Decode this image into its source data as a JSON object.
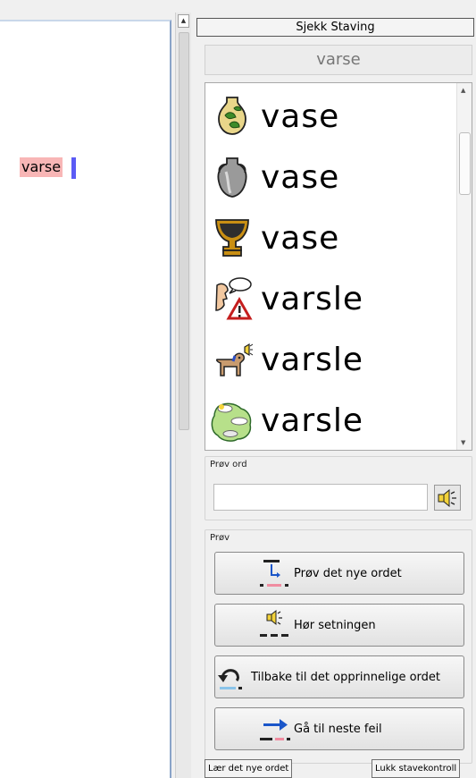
{
  "document": {
    "misspelled_word": "varse"
  },
  "panel": {
    "title": "Sjekk Staving",
    "current_word": "varse",
    "suggestions": [
      {
        "word": "vase",
        "icon": "green-vase-icon"
      },
      {
        "word": "vase",
        "icon": "grey-amphora-icon"
      },
      {
        "word": "vase",
        "icon": "trophy-urn-icon"
      },
      {
        "word": "varsle",
        "icon": "warn-speech-icon"
      },
      {
        "word": "varsle",
        "icon": "barking-dog-icon"
      },
      {
        "word": "varsle",
        "icon": "weather-map-icon"
      }
    ],
    "try_word": {
      "label": "Prøv ord",
      "value": "",
      "placeholder": ""
    },
    "try_group": {
      "label": "Prøv",
      "buttons": [
        {
          "label": "Prøv det nye ordet",
          "icon": "replace-word-icon"
        },
        {
          "label": "Hør setningen",
          "icon": "speaker-sentence-icon"
        },
        {
          "label": "Tilbake til det opprinnelige ordet",
          "icon": "undo-icon"
        },
        {
          "label": "Gå til neste feil",
          "icon": "next-error-icon"
        }
      ]
    },
    "learn_button": "Lær det nye ordet",
    "close_button": "Lukk stavekontroll"
  },
  "colors": {
    "error_highlight": "#f8b6b6",
    "caret": "#5b5bf5",
    "arrow_blue": "#1a56c9"
  }
}
